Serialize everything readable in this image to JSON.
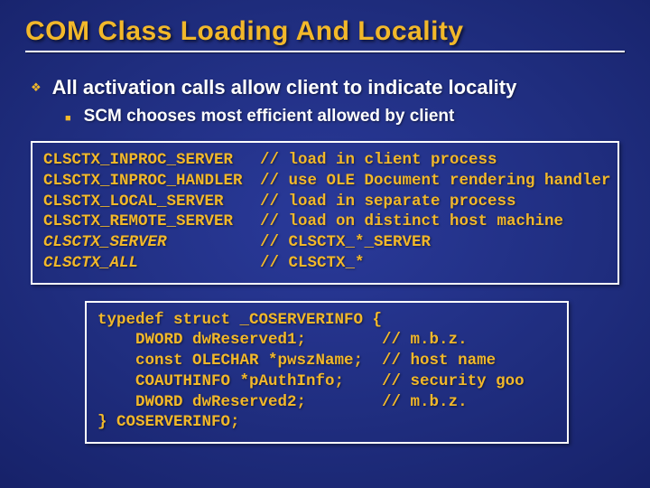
{
  "title": "COM Class Loading And Locality",
  "bullets": {
    "l1": "All activation calls allow client to indicate locality",
    "l2": "SCM chooses most efficient allowed by client"
  },
  "code1": {
    "rows": [
      {
        "left": "CLSCTX_INPROC_SERVER",
        "right": "// load in client process",
        "italic": false
      },
      {
        "left": "CLSCTX_INPROC_HANDLER",
        "right": "// use OLE Document rendering handler",
        "italic": false
      },
      {
        "left": "CLSCTX_LOCAL_SERVER",
        "right": "// load in separate process",
        "italic": false
      },
      {
        "left": "CLSCTX_REMOTE_SERVER",
        "right": "// load on distinct host machine",
        "italic": false
      },
      {
        "left": "CLSCTX_SERVER",
        "right": "// CLSCTX_*_SERVER",
        "italic": true
      },
      {
        "left": "CLSCTX_ALL",
        "right": "// CLSCTX_*",
        "italic": true
      }
    ]
  },
  "code2": {
    "lines": [
      "typedef struct _COSERVERINFO {",
      "    DWORD dwReserved1;        // m.b.z.",
      "    const OLECHAR *pwszName;  // host name",
      "    COAUTHINFO *pAuthInfo;    // security goo",
      "    DWORD dwReserved2;        // m.b.z.",
      "} COSERVERINFO;"
    ]
  }
}
